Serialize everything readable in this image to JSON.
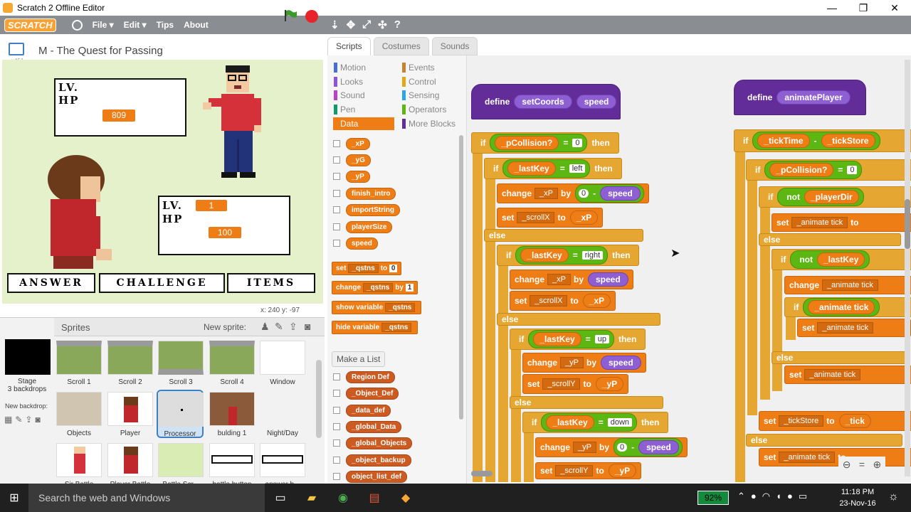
{
  "window": {
    "title": "Scratch 2 Offline Editor",
    "minimize": "—",
    "maximize": "❐",
    "close": "✕"
  },
  "menu": {
    "logo": "SCRATCH",
    "file": "File ▾",
    "edit": "Edit ▾",
    "tips": "Tips",
    "about": "About",
    "tools": [
      "⇣",
      "✥",
      "⤢",
      "✣",
      "?"
    ]
  },
  "stage": {
    "project_title": "M - The Quest for Passing",
    "version": "v451",
    "coords": "x: 240   y: -97",
    "hud1": {
      "lv": "LV.",
      "hp": "HP",
      "hp_value": "809"
    },
    "hud2": {
      "lv": "LV.",
      "hp": "HP",
      "lv_value": "1",
      "hp_value": "100"
    },
    "buttons": [
      "ANSWER",
      "CHALLENGE",
      "ITEMS"
    ]
  },
  "sprites": {
    "header": "Sprites",
    "new_sprite": "New sprite:",
    "stage_label": "Stage",
    "stage_sub": "3 backdrops",
    "new_backdrop": "New backdrop:",
    "items": [
      "Scroll 1",
      "Scroll 2",
      "Scroll 3",
      "Scroll 4",
      "Window",
      "Objects",
      "Player",
      "Processor",
      "bulding 1",
      "Night/Day",
      "Sir Battle",
      "Player Battle",
      "Battle Scr...",
      "battle button",
      "answer b..."
    ]
  },
  "tabs": [
    "Scripts",
    "Costumes",
    "Sounds"
  ],
  "categories": {
    "left": [
      "Motion",
      "Looks",
      "Sound",
      "Pen",
      "Data"
    ],
    "right": [
      "Events",
      "Control",
      "Sensing",
      "Operators",
      "More Blocks"
    ],
    "colors": {
      "Motion": "#4a6cd4",
      "Looks": "#8a55d7",
      "Sound": "#bb42c3",
      "Pen": "#0e9a6c",
      "Data": "#ee7d16",
      "Events": "#c88330",
      "Control": "#e1a91a",
      "Sensing": "#2ca5e2",
      "Operators": "#5cb712",
      "More Blocks": "#632d99"
    }
  },
  "variables": [
    "_xP",
    "_yG",
    "_yP",
    "finish_intro",
    "importString",
    "playerSize",
    "speed"
  ],
  "data_blocks": [
    {
      "a": "set",
      "var": "_qstns",
      "b": "to",
      "val": "0"
    },
    {
      "a": "change",
      "var": "_qstns",
      "b": "by",
      "val": "1"
    },
    {
      "a": "show variable",
      "var": "_qstns",
      "b": "",
      "val": ""
    },
    {
      "a": "hide variable",
      "var": "_qstns",
      "b": "",
      "val": ""
    }
  ],
  "make_list": "Make a List",
  "lists": [
    "Region Def",
    "_Object_Def",
    "_data_def",
    "_global_Data",
    "_global_Objects",
    "_object_backup",
    "object_list_def"
  ],
  "script1": {
    "define": "define",
    "name": "setCoords",
    "param": "speed",
    "if1": {
      "if": "if",
      "cond": "_pCollision?",
      "eq": "=",
      "val": "0",
      "then": "then"
    },
    "if2": {
      "if": "if",
      "var": "_lastKey",
      "eq": "=",
      "val": "left",
      "then": "then"
    },
    "change1": {
      "a": "change",
      "var": "_xP",
      "by": "by",
      "zero": "0",
      "minus": "-",
      "rep": "speed"
    },
    "set1": {
      "a": "set",
      "var": "_scrollX",
      "to": "to",
      "rep": "_xP"
    },
    "else": "else",
    "if3": {
      "if": "if",
      "var": "_lastKey",
      "eq": "=",
      "val": "right",
      "then": "then"
    },
    "change2": {
      "a": "change",
      "var": "_xP",
      "by": "by",
      "rep": "speed"
    },
    "set2": {
      "a": "set",
      "var": "_scrollX",
      "to": "to",
      "rep": "_xP"
    },
    "if4": {
      "if": "if",
      "var": "_lastKey",
      "eq": "=",
      "val": "up",
      "then": "then"
    },
    "change3": {
      "a": "change",
      "var": "_yP",
      "by": "by",
      "rep": "speed"
    },
    "set3": {
      "a": "set",
      "var": "_scrollY",
      "to": "to",
      "rep": "_yP"
    },
    "if5": {
      "if": "if",
      "var": "_lastKey",
      "eq": "=",
      "val": "down",
      "then": "then"
    },
    "change4": {
      "a": "change",
      "var": "_yP",
      "by": "by",
      "zero": "0",
      "minus": "-",
      "rep": "speed"
    },
    "set4": {
      "a": "set",
      "var": "_scrollY",
      "to": "to",
      "rep": "_yP"
    }
  },
  "script2": {
    "define": "define",
    "name": "animatePlayer",
    "tick": "_tickTime",
    "minus": "-",
    "store": "_tickStore",
    "pcol": "_pCollision?",
    "eq": "=",
    "val": "0",
    "not": "not",
    "pdir": "_playerDir",
    "lastkey": "_lastKey",
    "set": "set",
    "change": "change",
    "animtick": "_animate tick",
    "to": "to",
    "if": "if",
    "else": "else",
    "tickstore": "_tickStore",
    "tick_trunc": "_tick"
  },
  "zoom": [
    "⊖",
    "=",
    "⊕"
  ],
  "taskbar": {
    "search": "Search the web and Windows",
    "battery": "92%",
    "time": "11:18 PM",
    "date": "23-Nov-16"
  }
}
